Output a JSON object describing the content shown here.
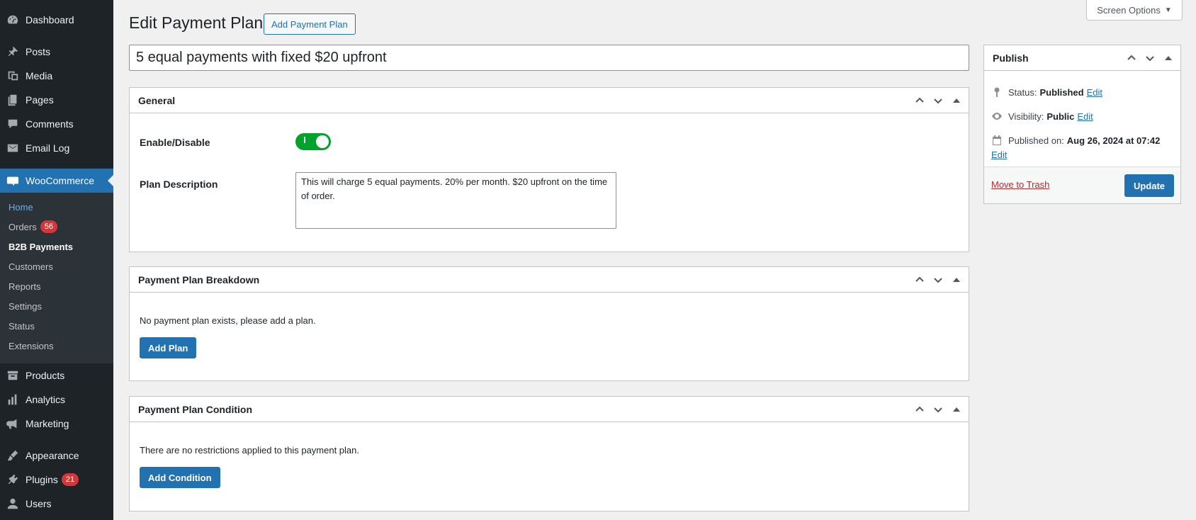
{
  "sidebar": {
    "items": [
      {
        "label": "Dashboard",
        "icon": "dashboard-icon"
      },
      {
        "label": "Posts",
        "icon": "pin-icon"
      },
      {
        "label": "Media",
        "icon": "media-icon"
      },
      {
        "label": "Pages",
        "icon": "pages-icon"
      },
      {
        "label": "Comments",
        "icon": "comment-icon"
      },
      {
        "label": "Email Log",
        "icon": "email-icon"
      },
      {
        "label": "WooCommerce",
        "icon": "woo-icon"
      },
      {
        "label": "Products",
        "icon": "archive-icon"
      },
      {
        "label": "Analytics",
        "icon": "chart-bar-icon"
      },
      {
        "label": "Marketing",
        "icon": "megaphone-icon"
      },
      {
        "label": "Appearance",
        "icon": "brush-icon"
      },
      {
        "label": "Plugins",
        "icon": "plugin-icon",
        "badge": "21"
      },
      {
        "label": "Users",
        "icon": "user-icon"
      }
    ],
    "submenu": [
      {
        "label": "Home"
      },
      {
        "label": "Orders",
        "badge": "56"
      },
      {
        "label": "B2B Payments"
      },
      {
        "label": "Customers"
      },
      {
        "label": "Reports"
      },
      {
        "label": "Settings"
      },
      {
        "label": "Status"
      },
      {
        "label": "Extensions"
      }
    ]
  },
  "screen_options": "Screen Options",
  "header": {
    "title": "Edit Payment Plan",
    "add_button": "Add Payment Plan"
  },
  "post_title": "5 equal payments with fixed $20 upfront",
  "general": {
    "heading": "General",
    "enable_label": "Enable/Disable",
    "enabled": true,
    "description_label": "Plan Description",
    "description": "This will charge 5 equal payments. 20% per month. $20 upfront on the time of order."
  },
  "breakdown": {
    "heading": "Payment Plan Breakdown",
    "empty_text": "No payment plan exists, please add a plan.",
    "add_button": "Add Plan"
  },
  "condition": {
    "heading": "Payment Plan Condition",
    "empty_text": "There are no restrictions applied to this payment plan.",
    "add_button": "Add Condition"
  },
  "publish": {
    "heading": "Publish",
    "status_label": "Status:",
    "status_value": "Published",
    "visibility_label": "Visibility:",
    "visibility_value": "Public",
    "published_label": "Published on:",
    "published_value": "Aug 26, 2024 at 07:42",
    "edit_link": "Edit",
    "trash_link": "Move to Trash",
    "update_button": "Update"
  },
  "colors": {
    "sidebar_bg": "#1d2327",
    "accent": "#2271b1",
    "toggle_on": "#00a32a",
    "badge": "#d63638",
    "trash": "#b32d2e"
  }
}
